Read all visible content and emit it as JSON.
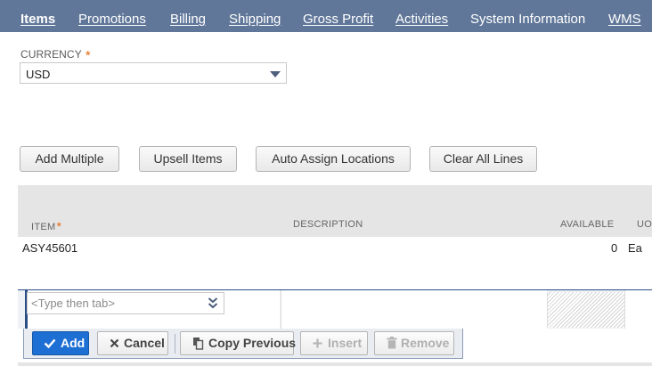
{
  "tabs": [
    {
      "label": "Items",
      "active": true
    },
    {
      "label": "Promotions",
      "active": false
    },
    {
      "label": "Billing",
      "active": false
    },
    {
      "label": "Shipping",
      "active": false
    },
    {
      "label": "Gross Profit",
      "active": false
    },
    {
      "label": "Activities",
      "active": false
    },
    {
      "label": "System Information",
      "active": false
    },
    {
      "label": "WMS",
      "active": false
    }
  ],
  "currency": {
    "label": "CURRENCY",
    "required_mark": "*",
    "value": "USD"
  },
  "actions": {
    "add_multiple": "Add Multiple",
    "upsell_items": "Upsell Items",
    "auto_assign_locations": "Auto Assign Locations",
    "clear_all_lines": "Clear All Lines"
  },
  "sublist": {
    "columns": {
      "item": "ITEM",
      "item_required": "*",
      "description": "DESCRIPTION",
      "available": "AVAILABLE",
      "uom": "UO"
    },
    "rows": [
      {
        "item": "ASY45601",
        "description": "",
        "available": "0",
        "uom": "Ea"
      }
    ],
    "edit_row": {
      "item_placeholder": "<Type then tab>"
    }
  },
  "row_toolbar": {
    "add": "Add",
    "cancel": "Cancel",
    "copy_previous": "Copy Previous",
    "insert": "Insert",
    "remove": "Remove"
  },
  "colors": {
    "tab_bar": "#607799",
    "primary_button": "#1d6fd4",
    "required": "#e36a10",
    "edit_row_accent": "#2a4d86"
  },
  "icons": {
    "currency_dropdown": "caret-down-icon",
    "item_dropdown": "double-chevron-down-icon",
    "add": "check-icon",
    "cancel": "x-icon",
    "copy_previous": "copy-icon",
    "insert": "plus-icon",
    "remove": "trash-icon"
  }
}
